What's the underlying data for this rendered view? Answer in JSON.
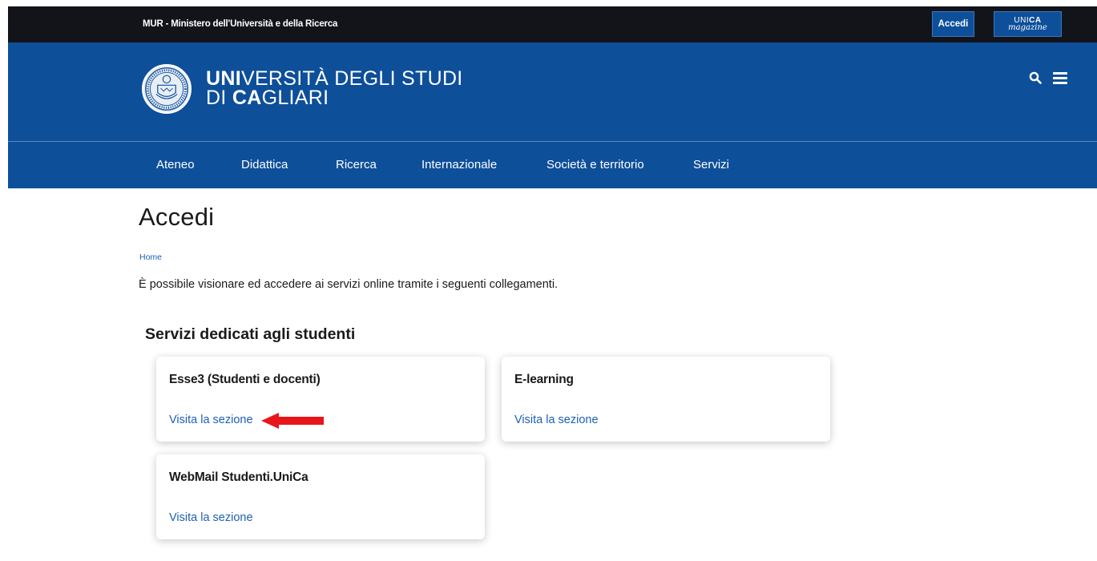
{
  "topbar": {
    "ministry": "MUR - Ministero dell'Università e della Ricerca",
    "login_button": "Accedi",
    "magazine": {
      "line1_a": "UNI",
      "line1_b": "CA",
      "line2": "magazine"
    }
  },
  "header": {
    "logo": {
      "line1_bold": "UNI",
      "line1_rest": "VERSITÀ DEGLI STUDI",
      "line2_start": "DI ",
      "line2_bold": "CA",
      "line2_rest": "GLIARI"
    },
    "icons": [
      "search-icon",
      "menu-icon"
    ]
  },
  "nav": {
    "items": [
      "Ateneo",
      "Didattica",
      "Ricerca",
      "Internazionale",
      "Società e territorio",
      "Servizi"
    ]
  },
  "page": {
    "title": "Accedi",
    "breadcrumb": "Home",
    "intro": "È possibile visionare ed accedere ai servizi online tramite i seguenti collegamenti.",
    "section_title": "Servizi dedicati agli studenti"
  },
  "cards": [
    {
      "title": "Esse3 (Studenti e docenti)",
      "link": "Visita la sezione"
    },
    {
      "title": "E-learning",
      "link": "Visita la sezione"
    },
    {
      "title": "WebMail Studenti.UniCa",
      "link": "Visita la sezione"
    }
  ],
  "colors": {
    "brand_blue": "#0e4f9a",
    "topbar": "#12141a",
    "link": "#1c61b3",
    "annotation_arrow": "#e8151b"
  }
}
